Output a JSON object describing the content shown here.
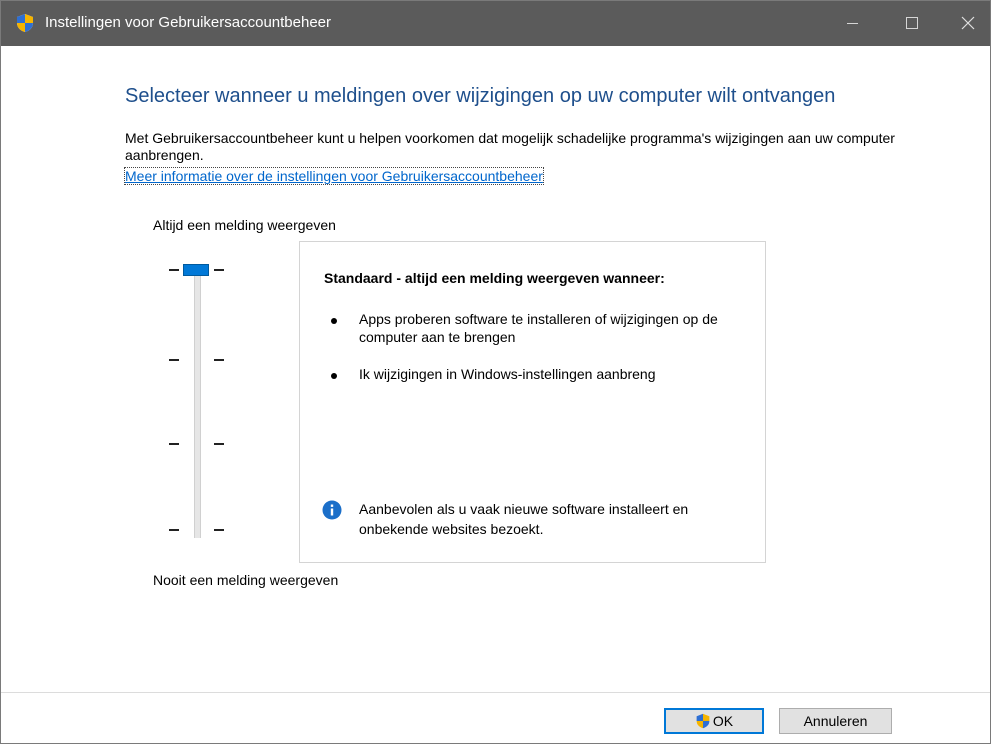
{
  "window": {
    "title": "Instellingen voor Gebruikersaccountbeheer",
    "icon": "uac-shield-icon"
  },
  "main": {
    "heading": "Selecteer wanneer u meldingen over wijzigingen op uw computer wilt ontvangen",
    "description": "Met Gebruikersaccountbeheer kunt u helpen voorkomen dat mogelijk schadelijke programma's wijzigingen aan uw computer aanbrengen.",
    "link": "Meer informatie over de instellingen voor Gebruikersaccountbeheer"
  },
  "slider": {
    "top_label": "Altijd een melding weergeven",
    "bottom_label": "Nooit een melding weergeven",
    "levels": 4,
    "selected_level": 4
  },
  "info": {
    "title": "Standaard - altijd een melding weergeven wanneer:",
    "bullets": [
      "Apps proberen software te installeren of wijzigingen op de computer aan te brengen",
      "Ik wijzigingen in Windows-instellingen aanbreng"
    ],
    "note": "Aanbevolen als u vaak nieuwe software installeert en onbekende websites bezoekt."
  },
  "buttons": {
    "ok": "OK",
    "cancel": "Annuleren"
  },
  "colors": {
    "titlebar": "#5b5b5b",
    "heading": "#1e4f8c",
    "link": "#0066cc",
    "accent": "#0078d7"
  }
}
